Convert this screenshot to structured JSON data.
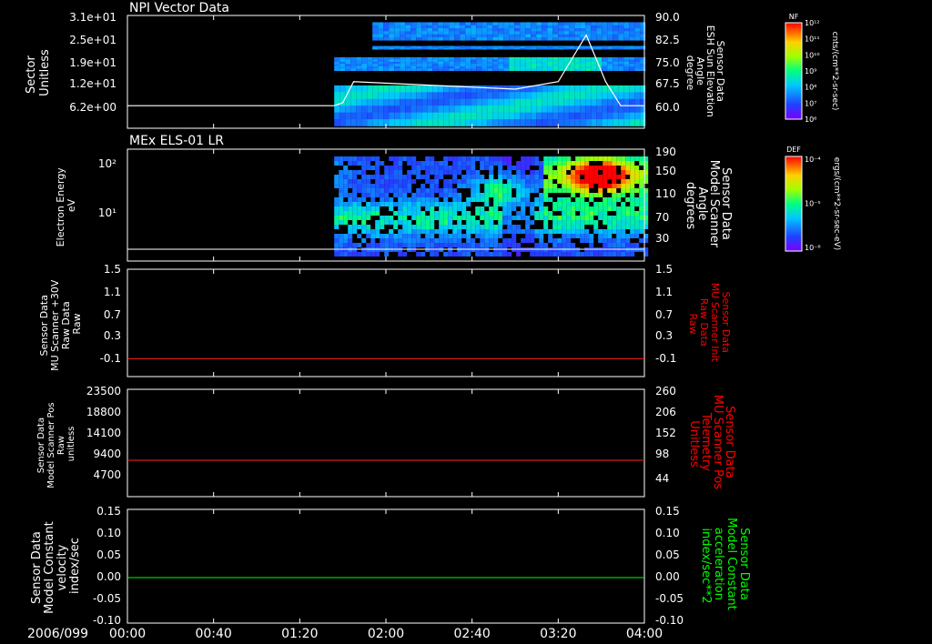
{
  "colors": {
    "background": "#000000",
    "axis": "#ffffff",
    "trace_white": "#ffffff",
    "trace_red": "#ff2020",
    "trace_green": "#00ff00",
    "label_red": "#ff0000",
    "label_green": "#00ff00"
  },
  "time_axis": {
    "date_label": "2006/099",
    "ticks": [
      "00:00",
      "00:40",
      "01:20",
      "02:00",
      "02:40",
      "03:20",
      "04:00"
    ],
    "range_minutes": [
      0,
      240
    ]
  },
  "chart_data": [
    {
      "type": "heatmap",
      "title": "NPI Vector Data",
      "ylabel": "Sector\nUnitless",
      "y_ticks": [
        "3.1e+01",
        "2.5e+01",
        "1.9e+01",
        "1.2e+01",
        "6.2e+00"
      ],
      "y2label": "Sensor Data\nESH Sun Elevation\nAngle\ndegree",
      "y2_ticks": [
        "90.0",
        "82.5",
        "75.0",
        "67.5",
        "60.0"
      ],
      "y2lim": [
        52.5,
        90.0
      ],
      "colorbar": {
        "label": "NF",
        "unit": "cnts/(cm**2-sr-sec)",
        "ticks": [
          "10¹²",
          "10¹¹",
          "10¹⁰",
          "10⁹",
          "10⁸",
          "10⁷",
          "10⁶"
        ]
      },
      "data_start_minutes": 96,
      "series": [
        {
          "name": "ESH Sun Elevation Angle",
          "x": [
            0,
            96,
            100,
            105,
            180,
            200,
            213,
            222,
            229,
            240
          ],
          "y": [
            60.0,
            60.0,
            61.0,
            68.0,
            65.5,
            68.0,
            83.5,
            68.0,
            60.0,
            60.0
          ]
        }
      ]
    },
    {
      "type": "heatmap",
      "title": "MEx ELS-01 LR",
      "ylabel": "Electron Energy\neV",
      "y_ticks": [
        "10²",
        "10¹"
      ],
      "y2label": "Sensor Data\nModel Scanner\nAngle\ndegrees",
      "y2_ticks": [
        "190",
        "150",
        "110",
        "70",
        "30"
      ],
      "y2lim": [
        0,
        190
      ],
      "colorbar": {
        "label": "DEF",
        "unit": "ergs/(cm**2-sr-sec-eV)",
        "ticks": [
          "10⁻⁴",
          "10⁻⁵",
          "10⁻⁶"
        ]
      },
      "data_start_minutes": 96,
      "series": [
        {
          "name": "Model Scanner Angle",
          "x": [
            0,
            96,
            240
          ],
          "y": [
            0,
            0,
            0
          ]
        }
      ]
    },
    {
      "type": "line",
      "ylabel": "Sensor Data\nMU Scanner +30V\nRaw Data\nRaw",
      "y_ticks": [
        "1.5",
        "1.1",
        "0.7",
        "0.3",
        "-0.1"
      ],
      "ylim": [
        -0.3,
        1.5
      ],
      "y2label": "Sensor Data\nMU Scanner Init\nRaw Data\nRaw",
      "y2_ticks": [
        "1.5",
        "1.1",
        "0.7",
        "0.3",
        "-0.1"
      ],
      "series": [
        {
          "name": "MU Scanner Init",
          "x": [
            0,
            240
          ],
          "y": [
            0.0,
            0.0
          ]
        }
      ]
    },
    {
      "type": "line",
      "ylabel": "Sensor Data\nModel Scanner Pos\nRaw\nunitless",
      "y_ticks": [
        "23500",
        "18800",
        "14100",
        "9400",
        "4700"
      ],
      "y2label": "Sensor Data\nMU Scanner Pos\nTelemetry\nUnitless",
      "y2_ticks": [
        "260",
        "206",
        "152",
        "98",
        "44"
      ],
      "y2lim": [
        0,
        260
      ],
      "series": [
        {
          "name": "MU Scanner Pos Telemetry",
          "x": [
            0,
            240
          ],
          "y": [
            88,
            88
          ]
        }
      ]
    },
    {
      "type": "line",
      "ylabel": "Sensor Data\nModel Constant\nvelocity\nindex/sec",
      "y_ticks": [
        "0.15",
        "0.10",
        "0.05",
        "0.00",
        "-0.05",
        "-0.10"
      ],
      "ylim": [
        -0.1,
        0.15
      ],
      "y2label": "Sensor Data\nModel Constant\nacceleration\nindex/sec**2",
      "y2_ticks": [
        "0.15",
        "0.10",
        "0.05",
        "0.00",
        "-0.05",
        "-0.10"
      ],
      "series": [
        {
          "name": "Model Constant",
          "x": [
            0,
            240
          ],
          "y": [
            0.0,
            0.0
          ]
        }
      ]
    }
  ]
}
